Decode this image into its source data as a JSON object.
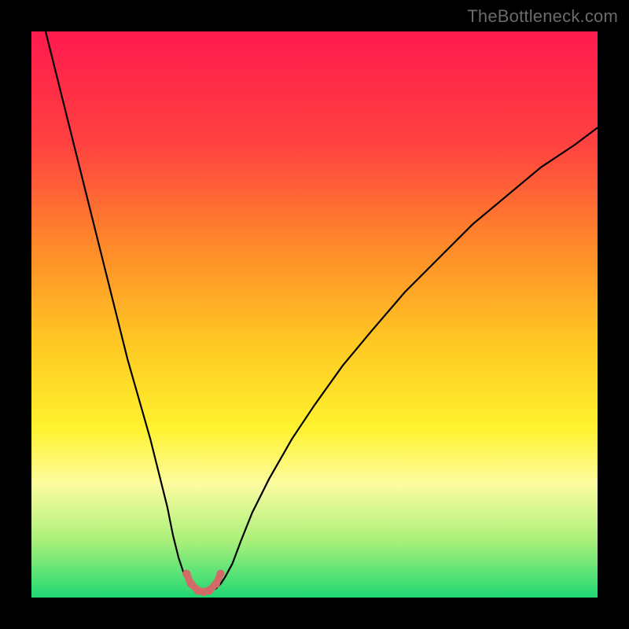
{
  "watermark": "TheBottleneck.com",
  "chart_data": {
    "type": "line",
    "title": "",
    "xlabel": "",
    "ylabel": "",
    "xlim": [
      0,
      100
    ],
    "ylim": [
      0,
      100
    ],
    "background_gradient": {
      "stops": [
        {
          "offset": 0,
          "color": "#ff1a4e"
        },
        {
          "offset": 20,
          "color": "#ff4240"
        },
        {
          "offset": 38,
          "color": "#ff8a2a"
        },
        {
          "offset": 55,
          "color": "#ffc823"
        },
        {
          "offset": 70,
          "color": "#fff22e"
        },
        {
          "offset": 80,
          "color": "#fcfca0"
        },
        {
          "offset": 90,
          "color": "#a9f07a"
        },
        {
          "offset": 100,
          "color": "#1fd873"
        }
      ]
    },
    "series": [
      {
        "name": "bottleneck-curve",
        "stroke": "#000000",
        "stroke_width": 2.2,
        "points": [
          [
            2.5,
            100
          ],
          [
            3.5,
            96
          ],
          [
            5,
            90
          ],
          [
            7,
            82
          ],
          [
            9,
            74
          ],
          [
            11,
            66
          ],
          [
            13,
            58
          ],
          [
            15,
            50
          ],
          [
            17,
            42
          ],
          [
            19,
            35
          ],
          [
            21,
            28
          ],
          [
            22.5,
            22
          ],
          [
            24,
            16
          ],
          [
            25,
            11
          ],
          [
            26,
            7
          ],
          [
            27,
            4
          ],
          [
            27.8,
            2.5
          ],
          [
            28.6,
            1.6
          ],
          [
            29.4,
            1.2
          ],
          [
            30.2,
            1.0
          ],
          [
            31.0,
            1.0
          ],
          [
            31.8,
            1.2
          ],
          [
            32.6,
            1.6
          ],
          [
            33.4,
            2.4
          ],
          [
            34.2,
            3.6
          ],
          [
            35.5,
            6
          ],
          [
            37,
            10
          ],
          [
            39,
            15
          ],
          [
            42,
            21
          ],
          [
            46,
            28
          ],
          [
            50,
            34
          ],
          [
            55,
            41
          ],
          [
            60,
            47
          ],
          [
            66,
            54
          ],
          [
            72,
            60
          ],
          [
            78,
            66
          ],
          [
            84,
            71
          ],
          [
            90,
            76
          ],
          [
            96,
            80
          ],
          [
            100,
            83
          ]
        ]
      },
      {
        "name": "trough-marker",
        "stroke": "#d26a68",
        "stroke_width": 9,
        "linecap": "round",
        "points": [
          [
            27.4,
            4.2
          ],
          [
            28.0,
            2.8
          ],
          [
            28.8,
            1.8
          ],
          [
            29.6,
            1.2
          ],
          [
            30.4,
            1.0
          ],
          [
            31.2,
            1.2
          ],
          [
            32.0,
            1.8
          ],
          [
            32.8,
            2.8
          ],
          [
            33.4,
            4.2
          ]
        ],
        "dots": [
          [
            27.4,
            4.2
          ],
          [
            28.2,
            2.4
          ],
          [
            29.4,
            1.2
          ],
          [
            30.4,
            1.0
          ],
          [
            31.4,
            1.2
          ],
          [
            32.6,
            2.4
          ],
          [
            33.4,
            4.2
          ]
        ],
        "dot_radius": 5.2
      }
    ]
  }
}
